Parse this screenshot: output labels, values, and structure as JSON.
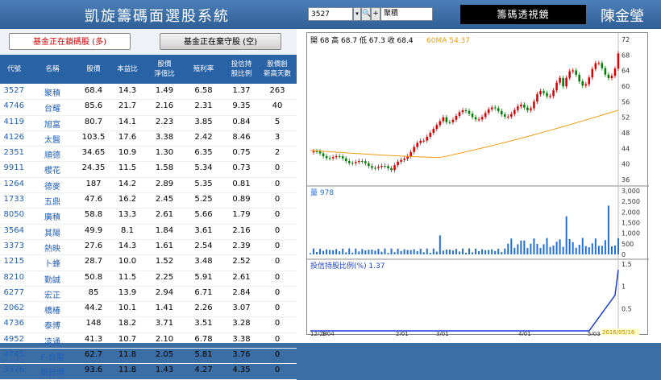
{
  "app": {
    "title": "凱旋籌碼面選股系統",
    "author": "陳金瑩",
    "chip_button": "籌碼透視鏡"
  },
  "stock_picker": {
    "code": "3527",
    "name": "聚積"
  },
  "tabs": [
    {
      "label": "基金正在鎖碼股 (多)"
    },
    {
      "label": "基金正在棄守股 (空)"
    }
  ],
  "table": {
    "headers": [
      "代號",
      "名稱",
      "股價",
      "本益比",
      "股價\n淨值比",
      "殖利率",
      "投信持\n股比例",
      "股價創\n新高天數"
    ],
    "rows": [
      [
        "3527",
        "聚積",
        "68.4",
        "14.3",
        "1.49",
        "6.58",
        "1.37",
        "263"
      ],
      [
        "4746",
        "台耀",
        "85.6",
        "21.7",
        "2.16",
        "2.31",
        "9.35",
        "40"
      ],
      [
        "4119",
        "旭富",
        "80.7",
        "14.1",
        "2.23",
        "3.85",
        "0.84",
        "5"
      ],
      [
        "4126",
        "太醫",
        "103.5",
        "17.6",
        "3.38",
        "2.42",
        "8.46",
        "3"
      ],
      [
        "2351",
        "順德",
        "34.65",
        "10.9",
        "1.30",
        "6.35",
        "0.75",
        "2"
      ],
      [
        "9911",
        "櫻花",
        "24.35",
        "11.5",
        "1.58",
        "5.34",
        "0.73",
        "0"
      ],
      [
        "1264",
        "德麥",
        "187",
        "14.2",
        "2.89",
        "5.35",
        "0.81",
        "0"
      ],
      [
        "1733",
        "五鼎",
        "47.6",
        "16.2",
        "2.45",
        "5.25",
        "0.89",
        "0"
      ],
      [
        "8050",
        "廣積",
        "58.8",
        "13.3",
        "2.61",
        "5.66",
        "1.79",
        "0"
      ],
      [
        "3564",
        "其陽",
        "49.9",
        "8.1",
        "1.84",
        "3.61",
        "2.16",
        "0"
      ],
      [
        "3373",
        "熱映",
        "27.6",
        "14.3",
        "1.61",
        "2.54",
        "2.39",
        "0"
      ],
      [
        "1215",
        "卜蜂",
        "28.7",
        "10.0",
        "1.52",
        "3.48",
        "2.52",
        "0"
      ],
      [
        "8210",
        "勤誠",
        "50.8",
        "11.5",
        "2.25",
        "5.91",
        "2.61",
        "0"
      ],
      [
        "6277",
        "宏正",
        "85",
        "13.9",
        "2.94",
        "6.71",
        "2.84",
        "0"
      ],
      [
        "2062",
        "橋椿",
        "44.2",
        "10.1",
        "1.41",
        "2.26",
        "3.07",
        "0"
      ],
      [
        "4736",
        "泰博",
        "148",
        "18.2",
        "3.71",
        "3.51",
        "3.28",
        "0"
      ],
      [
        "4952",
        "凌通",
        "41.3",
        "10.7",
        "2.10",
        "6.78",
        "3.38",
        "0"
      ],
      [
        "4745",
        "F-合富",
        "62.7",
        "11.8",
        "2.05",
        "5.81",
        "3.76",
        "0"
      ],
      [
        "3376",
        "新日興",
        "93.6",
        "11.8",
        "1.43",
        "4.27",
        "4.35",
        "0"
      ]
    ]
  },
  "chart": {
    "ohlc_label": "開 68  高 68.7  低 67.3  收 68.4",
    "ma_label": "60MA 54.37",
    "price_ticks": [
      "72",
      "68",
      "64",
      "60",
      "56",
      "52",
      "48",
      "44",
      "40",
      "36"
    ],
    "volume_label": "量 978",
    "volume_ticks": [
      "3,000",
      "2,500",
      "2,000",
      "1,500",
      "1,000",
      "500",
      "0"
    ],
    "holding_label": "投信持股比例(%) 1.37",
    "holding_ticks": [
      "1.5",
      "1",
      "0.5",
      "0"
    ],
    "x_ticks": [
      "12/28",
      "1/04",
      "2/01",
      "3/01",
      "4/01",
      "5/03"
    ],
    "date_badge": "2016/05/16",
    "colors": {
      "up": "#e00000",
      "down": "#008000",
      "ma": "#f39c12",
      "volume": "#1f6fd6",
      "holding": "#1a3fd9"
    }
  }
}
